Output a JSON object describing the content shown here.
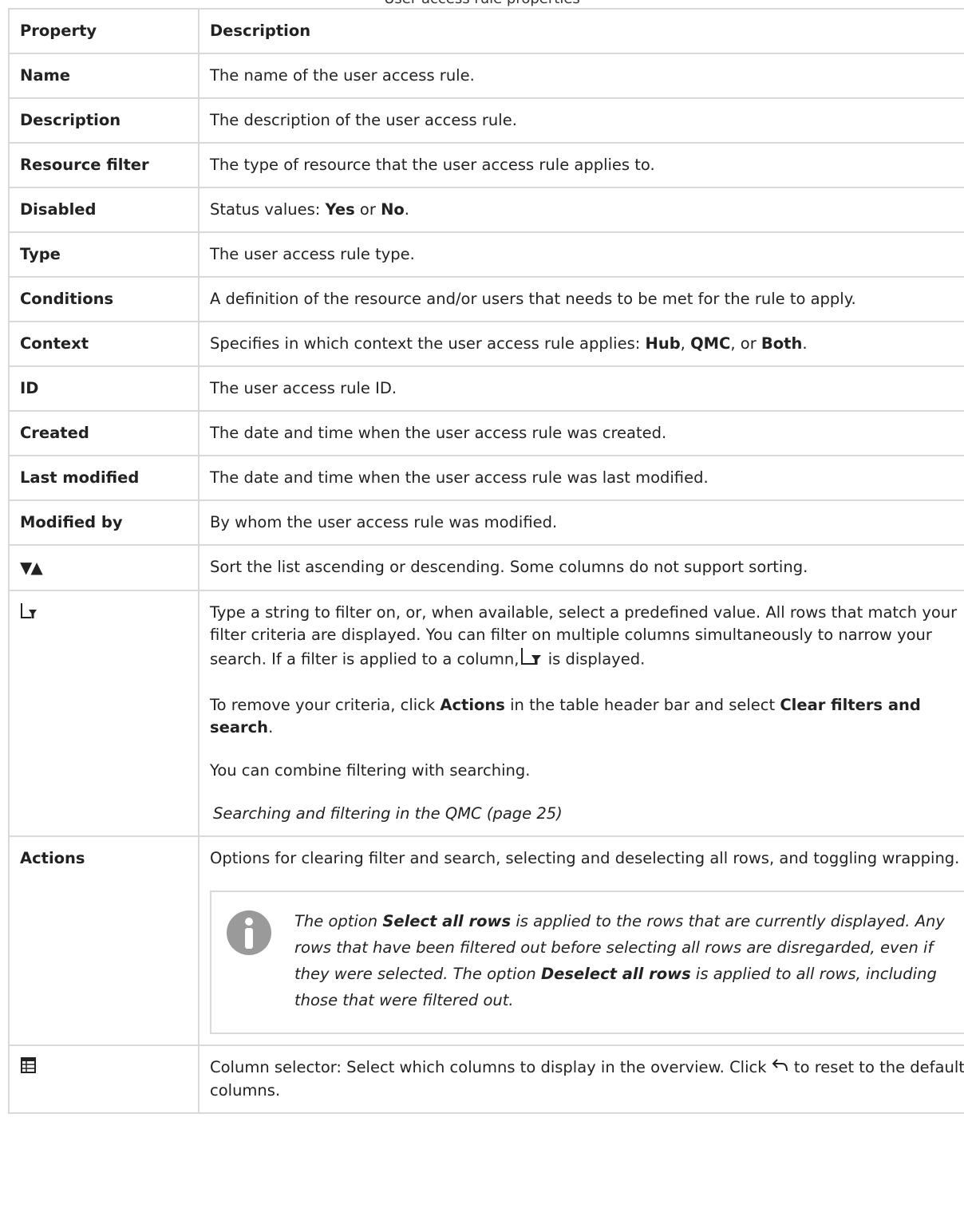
{
  "caption": "User access rule properties",
  "table": {
    "headers": [
      "Property",
      "Description"
    ],
    "rows": [
      {
        "property": "Name",
        "description": "The name of the user access rule."
      },
      {
        "property": "Description",
        "description": "The description of the user access rule."
      },
      {
        "property": "Resource filter",
        "description": "The type of resource that the user access rule applies to."
      },
      {
        "property": "Type",
        "description": "The user access rule type."
      },
      {
        "property": "Conditions",
        "description": "A definition of the resource and/or users that needs to be met for the rule to apply."
      },
      {
        "property": "ID",
        "description": "The user access rule ID."
      },
      {
        "property": "Created",
        "description": "The date and time when the user access rule was created."
      },
      {
        "property": "Last modified",
        "description": "The date and time when the user access rule was last modified."
      },
      {
        "property": "Modified by",
        "description": "By whom the user access rule was modified."
      }
    ],
    "disabled": {
      "property": "Disabled",
      "prefix": "Status values: ",
      "yes": "Yes",
      "or": " or ",
      "no": "No",
      "end": "."
    },
    "context": {
      "property": "Context",
      "prefix": "Specifies in which context the user access rule applies: ",
      "hub": "Hub",
      "comma1": ", ",
      "qmc": "QMC",
      "or": ", or ",
      "both": "Both",
      "end": "."
    },
    "sort": {
      "glyphs": "▼▲",
      "description": "Sort the list ascending or descending. Some columns do not support sorting."
    },
    "filter": {
      "icon": "filter-icon",
      "p1_a": "Type a string to filter on, or, when available, select a predefined value. All rows that match your filter criteria are displayed. You can filter on multiple columns simultaneously to narrow your search. If a filter is applied to a column,",
      "p1_b": " is displayed.",
      "p2_a": "To remove your criteria, click ",
      "p2_actions": "Actions",
      "p2_b": " in the table header bar and select ",
      "p2_clear": "Clear filters and search",
      "p2_c": ".",
      "p3": "You can combine filtering with searching.",
      "link": "Searching and filtering in the QMC (page 25)"
    },
    "actions": {
      "property": "Actions",
      "description": "Options for clearing filter and search, selecting and deselecting all rows, and toggling wrapping.",
      "note_a": "The option ",
      "note_select": "Select all rows",
      "note_b": " is applied to the rows that are currently displayed. Any rows that have been filtered out before selecting all rows are disregarded, even if they were selected. The option ",
      "note_deselect": "Deselect all rows",
      "note_c": " is applied to all rows, including those that were filtered out."
    },
    "column_selector": {
      "icon": "column-selector-icon",
      "a": "Column selector: Select which columns to display in the overview. Click ",
      "b": " to reset to the default columns."
    }
  }
}
